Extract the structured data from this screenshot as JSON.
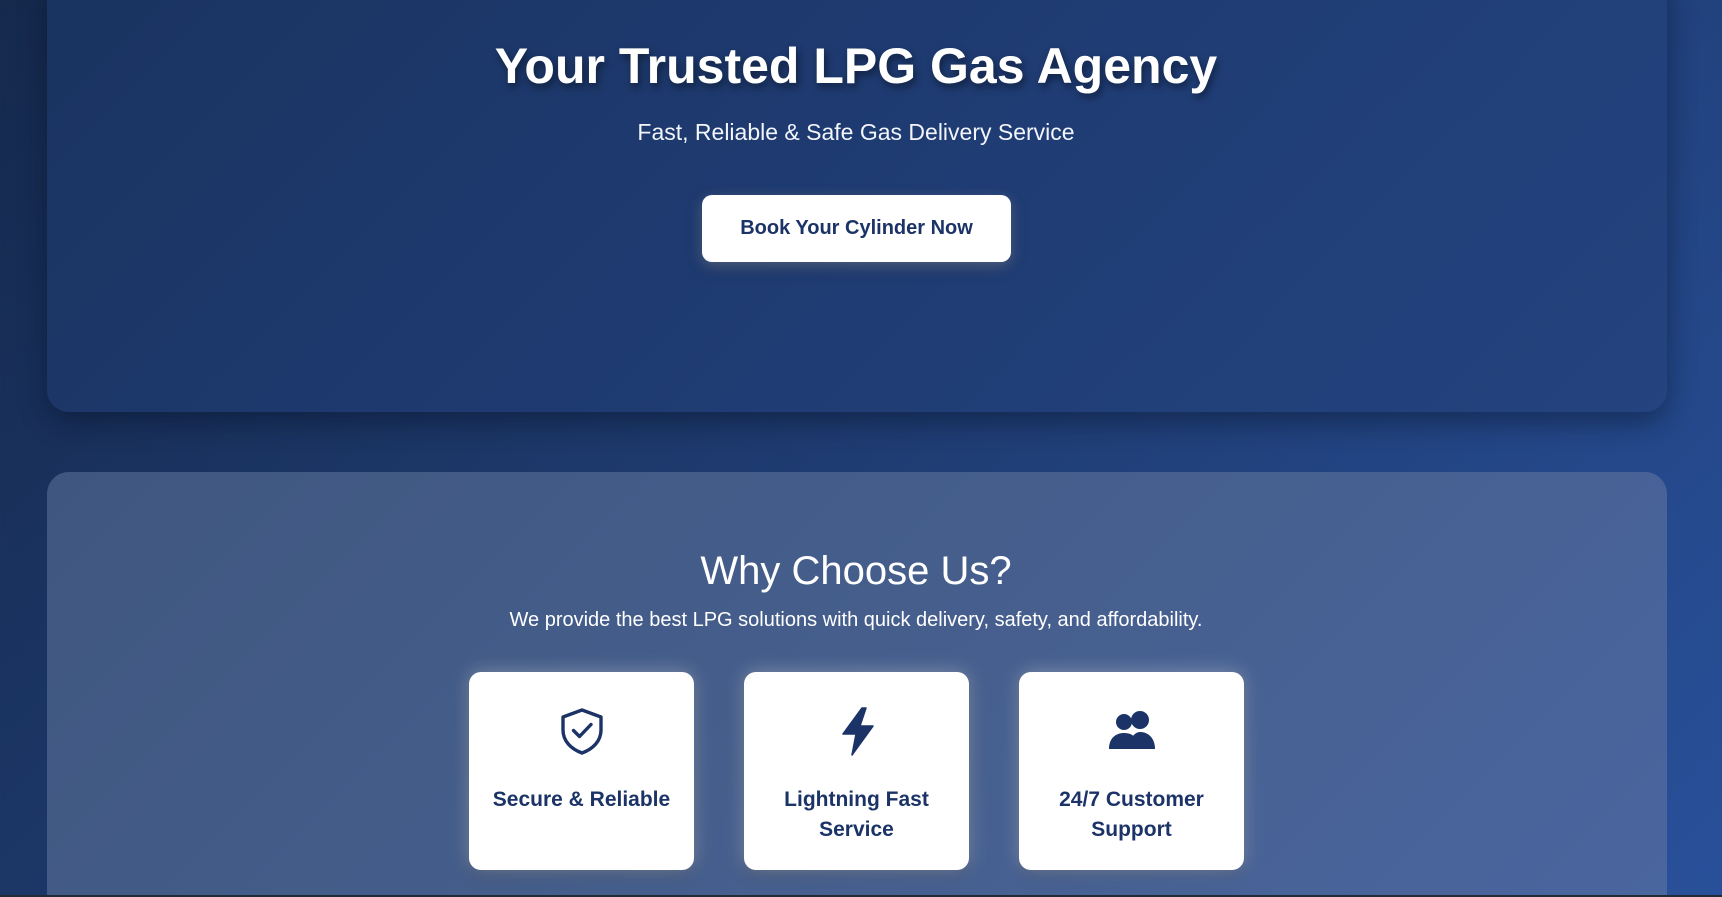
{
  "hero": {
    "title": "Your Trusted LPG Gas Agency",
    "subtitle": "Fast, Reliable & Safe Gas Delivery Service",
    "cta_label": "Book Your Cylinder Now"
  },
  "why": {
    "title": "Why Choose Us?",
    "description": "We provide the best LPG solutions with quick delivery, safety, and affordability.",
    "features": [
      {
        "icon": "shield-check-icon",
        "label": "Secure & Reliable"
      },
      {
        "icon": "lightning-bolt-icon",
        "label": "Lightning Fast Service"
      },
      {
        "icon": "users-icon",
        "label": "24/7 Customer Support"
      }
    ]
  },
  "colors": {
    "background": "#1e3a6e",
    "hero_panel": "#1f3c74",
    "why_panel": "#465f8e",
    "card": "#ffffff",
    "accent_text": "#1b3366"
  }
}
